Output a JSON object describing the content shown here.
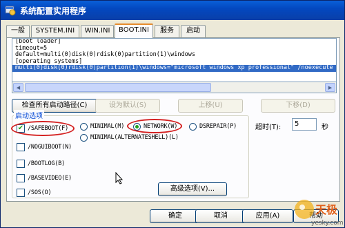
{
  "window": {
    "title": "系统配置实用程序"
  },
  "tabs": [
    {
      "label": "一般"
    },
    {
      "label": "SYSTEM.INI"
    },
    {
      "label": "WIN.INI"
    },
    {
      "label": "BOOT.INI"
    },
    {
      "label": "服务"
    },
    {
      "label": "启动"
    }
  ],
  "boot_ini": {
    "lines": [
      "[boot loader]",
      "timeout=5",
      "default=multi(0)disk(0)rdisk(0)partition(1)\\windows",
      "[operating systems]",
      "multi(0)disk(0)rdisk(0)partition(1)\\windows=\"microsoft windows xp professional\" /noexecute"
    ],
    "selected_index": 4
  },
  "buttons": {
    "check_paths": "检查所有启动路径(C)",
    "set_default": "设为默认(S)",
    "move_up": "上移(U)",
    "move_down": "下移(D)",
    "advanced": "高级选项(V)...",
    "ok": "确定",
    "cancel": "取消",
    "apply": "应用(A)",
    "help": "帮助"
  },
  "boot_options": {
    "legend": "启动选项",
    "safeboot": "/SAFEBOOT(F)",
    "minimal": "MINIMAL(M)",
    "network": "NETWORK(W)",
    "dsrepair": "DSREPAIR(P)",
    "minimal_alt": "MINIMAL(ALTERNATESHELL)(L)",
    "noguiboot": "/NOGUIBOOT(N)",
    "bootlog": "/BOOTLOG(B)",
    "basevideo": "/BASEVIDEO(E)",
    "sos": "/SOS(O)",
    "safeboot_checked": true,
    "selected_mode": "NETWORK"
  },
  "timeout": {
    "label": "超时(T):",
    "value": "5",
    "unit": "秒"
  },
  "watermark": {
    "text": "天极",
    "site": "yesky.com"
  },
  "colors": {
    "accent": "#e68b2c",
    "selection": "#316ac5",
    "annotation": "#d42020",
    "check": "#21a121"
  }
}
